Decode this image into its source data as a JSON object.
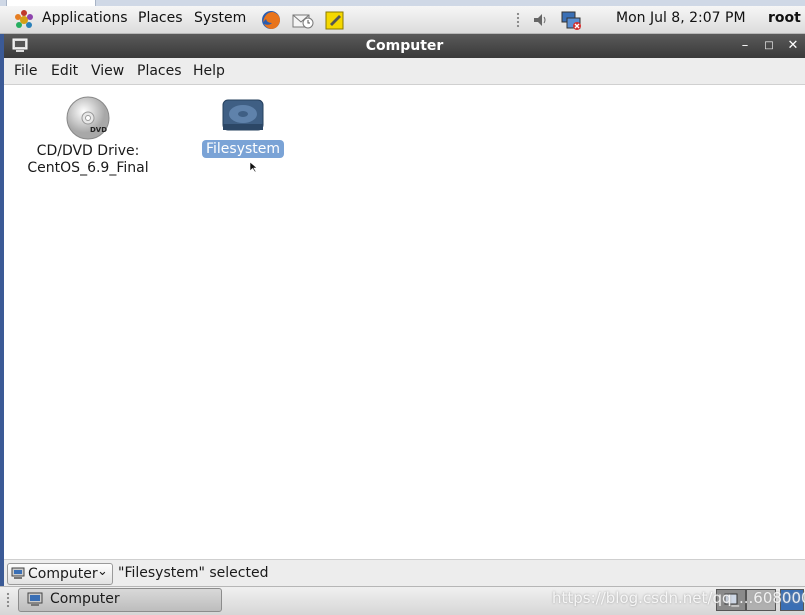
{
  "top_panel": {
    "applications_label": "Applications",
    "places_label": "Places",
    "system_label": "System",
    "clock": "Mon Jul  8,  2:07 PM",
    "user": "root"
  },
  "window": {
    "title": "Computer",
    "menus": [
      "File",
      "Edit",
      "View",
      "Places",
      "Help"
    ]
  },
  "items": [
    {
      "label_line1": "CD/DVD Drive:",
      "label_line2": "CentOS_6.9_Final",
      "icon": "dvd-icon",
      "selected": false
    },
    {
      "label_line1": "Filesystem",
      "icon": "hard-drive-icon",
      "selected": true
    }
  ],
  "statusbar": {
    "location": "Computer",
    "status": "\"Filesystem\" selected"
  },
  "taskbar": {
    "task_label": "Computer",
    "watermark": "https://blog.csdn.net/qq_...608000"
  },
  "colors": {
    "selection": "#7aa3d6",
    "titlebar": "#444444",
    "desktop_edge": "#3b5a96"
  }
}
